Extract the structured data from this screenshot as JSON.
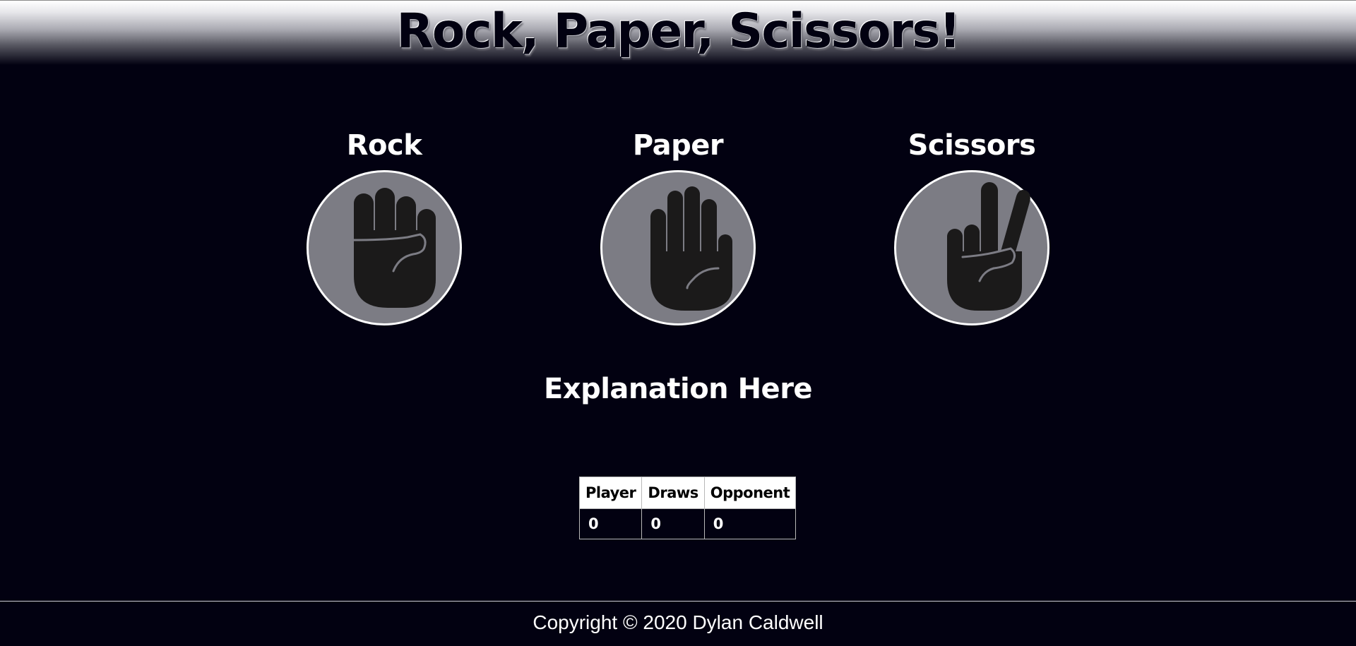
{
  "header": {
    "title": "Rock, Paper, Scissors!"
  },
  "choices": [
    {
      "label": "Rock",
      "icon": "fist-icon"
    },
    {
      "label": "Paper",
      "icon": "open-hand-icon"
    },
    {
      "label": "Scissors",
      "icon": "peace-hand-icon"
    }
  ],
  "explanation": "Explanation Here",
  "scoreboard": {
    "headers": [
      "Player",
      "Draws",
      "Opponent"
    ],
    "values": [
      "0",
      "0",
      "0"
    ]
  },
  "footer": {
    "copyright": "Copyright © 2020 Dylan Caldwell"
  },
  "colors": {
    "background": "#020111",
    "circle_fill": "#7c7c84",
    "hand_fill": "#1b1a1a"
  }
}
